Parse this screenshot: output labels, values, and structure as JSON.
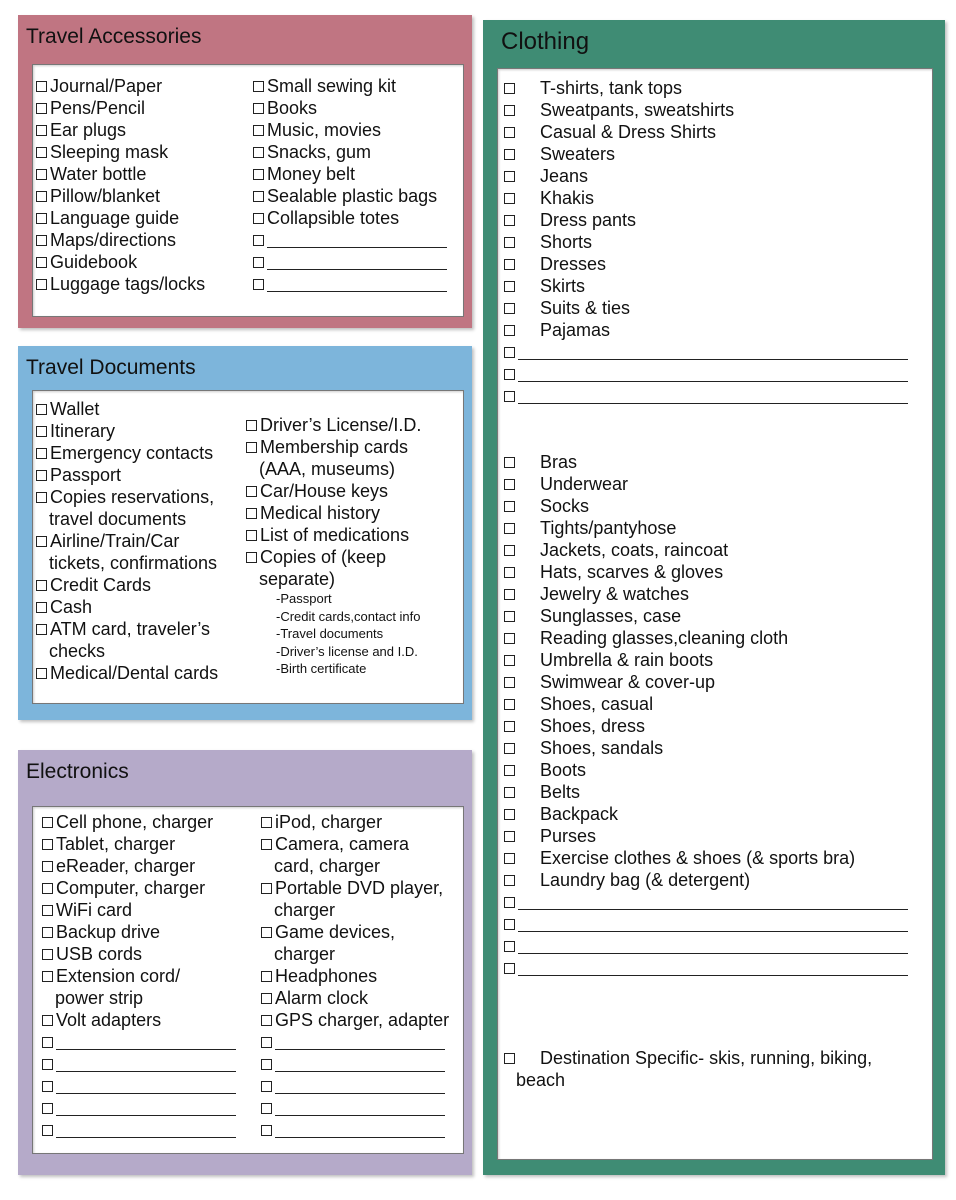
{
  "colors": {
    "accessories": "#c07582",
    "documents": "#7db5db",
    "electronics": "#b5aac9",
    "clothing": "#3f8c74"
  },
  "accessories": {
    "title": "Travel Accessories",
    "col1": [
      [
        "Journal/Paper"
      ],
      [
        "Pens/Pencil"
      ],
      [
        "Ear plugs"
      ],
      [
        "Sleeping mask"
      ],
      [
        "Water bottle"
      ],
      [
        "Pillow/blanket"
      ],
      [
        "Language guide"
      ],
      [
        "Maps/directions"
      ],
      [
        "Guidebook"
      ],
      [
        "Luggage tags/locks"
      ]
    ],
    "col2": [
      [
        "Small sewing kit"
      ],
      [
        "Books"
      ],
      [
        "Music, movies"
      ],
      [
        "Snacks, gum"
      ],
      [
        "Money belt"
      ],
      [
        "Sealable plastic bags"
      ],
      [
        "Collapsible totes"
      ],
      [
        ""
      ],
      [
        ""
      ],
      [
        ""
      ]
    ]
  },
  "documents": {
    "title": "Travel Documents",
    "col1": [
      [
        "Wallet"
      ],
      [
        "Itinerary"
      ],
      [
        "Emergency contacts"
      ],
      [
        "Passport"
      ],
      [
        "Copies reservations,",
        "travel documents"
      ],
      [
        "Airline/Train/Car",
        "tickets, confirmations"
      ],
      [
        "Credit Cards"
      ],
      [
        "Cash"
      ],
      [
        "ATM card, traveler’s",
        "checks"
      ],
      [
        "Medical/Dental cards"
      ]
    ],
    "col2": [
      [
        "Driver’s License/I.D."
      ],
      [
        "Membership cards",
        "(AAA, museums)"
      ],
      [
        "Car/House keys"
      ],
      [
        "Medical history"
      ],
      [
        "List of medications"
      ],
      [
        "Copies of (keep",
        "separate)"
      ]
    ],
    "sub": [
      "-Passport",
      "-Credit cards,contact info",
      "-Travel documents",
      "-Driver’s license and I.D.",
      "-Birth certificate"
    ]
  },
  "electronics": {
    "title": "Electronics",
    "col1": [
      [
        "Cell phone, charger"
      ],
      [
        "Tablet, charger"
      ],
      [
        "eReader, charger"
      ],
      [
        "Computer, charger"
      ],
      [
        "WiFi card"
      ],
      [
        "Backup drive"
      ],
      [
        "USB cords"
      ],
      [
        "Extension cord/",
        "power strip"
      ],
      [
        "Volt adapters"
      ],
      [
        ""
      ],
      [
        ""
      ],
      [
        ""
      ],
      [
        ""
      ],
      [
        ""
      ]
    ],
    "col2": [
      [
        "iPod, charger"
      ],
      [
        "Camera, camera",
        "card, charger"
      ],
      [
        "Portable DVD player,",
        "charger"
      ],
      [
        "Game devices,",
        "charger"
      ],
      [
        "Headphones"
      ],
      [
        "Alarm clock"
      ],
      [
        "GPS charger, adapter"
      ],
      [
        ""
      ],
      [
        ""
      ],
      [
        ""
      ],
      [
        ""
      ],
      [
        ""
      ]
    ]
  },
  "clothing": {
    "title": "Clothing",
    "group1": [
      "T-shirts, tank tops",
      "Sweatpants, sweatshirts",
      "Casual & Dress Shirts",
      "Sweaters",
      "Jeans",
      "Khakis",
      "Dress pants",
      "Shorts",
      "Dresses",
      "Skirts",
      "Suits & ties",
      "Pajamas",
      "",
      "",
      ""
    ],
    "group2": [
      "Bras",
      "Underwear",
      "Socks",
      "Tights/pantyhose",
      "Jackets, coats, raincoat",
      "Hats, scarves & gloves",
      "Jewelry & watches",
      "Sunglasses, case",
      "Reading glasses,cleaning cloth",
      "Umbrella & rain boots",
      "Swimwear & cover-up",
      "Shoes, casual",
      "Shoes, dress",
      "Shoes, sandals",
      "Boots",
      "Belts",
      "Backpack",
      "Purses",
      "Exercise clothes & shoes (& sports bra)",
      "Laundry bag (& detergent)",
      "",
      "",
      "",
      ""
    ],
    "destination": [
      "Destination Specific- skis, running, biking,",
      "beach"
    ]
  }
}
